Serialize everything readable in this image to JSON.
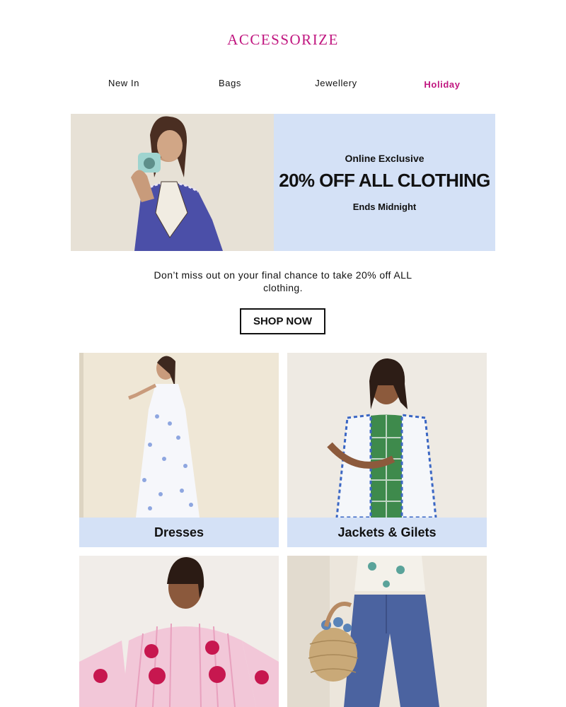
{
  "brand": {
    "logo": "ACCESSORIZE",
    "color": "#c0157f"
  },
  "nav": {
    "items": [
      {
        "label": "New In"
      },
      {
        "label": "Bags"
      },
      {
        "label": "Jewellery"
      },
      {
        "label": "Holiday",
        "highlight": true
      }
    ]
  },
  "hero": {
    "kicker": "Online Exclusive",
    "title": "20% OFF ALL CLOTHING",
    "subtitle": "Ends Midnight",
    "panel_color": "#d4e1f6"
  },
  "intro": {
    "text": "Don’t miss out on your final chance to take 20% off ALL clothing."
  },
  "cta": {
    "label": "SHOP NOW"
  },
  "categories": [
    {
      "label": "Dresses"
    },
    {
      "label": "Jackets & Gilets"
    },
    {
      "label": ""
    },
    {
      "label": ""
    }
  ]
}
